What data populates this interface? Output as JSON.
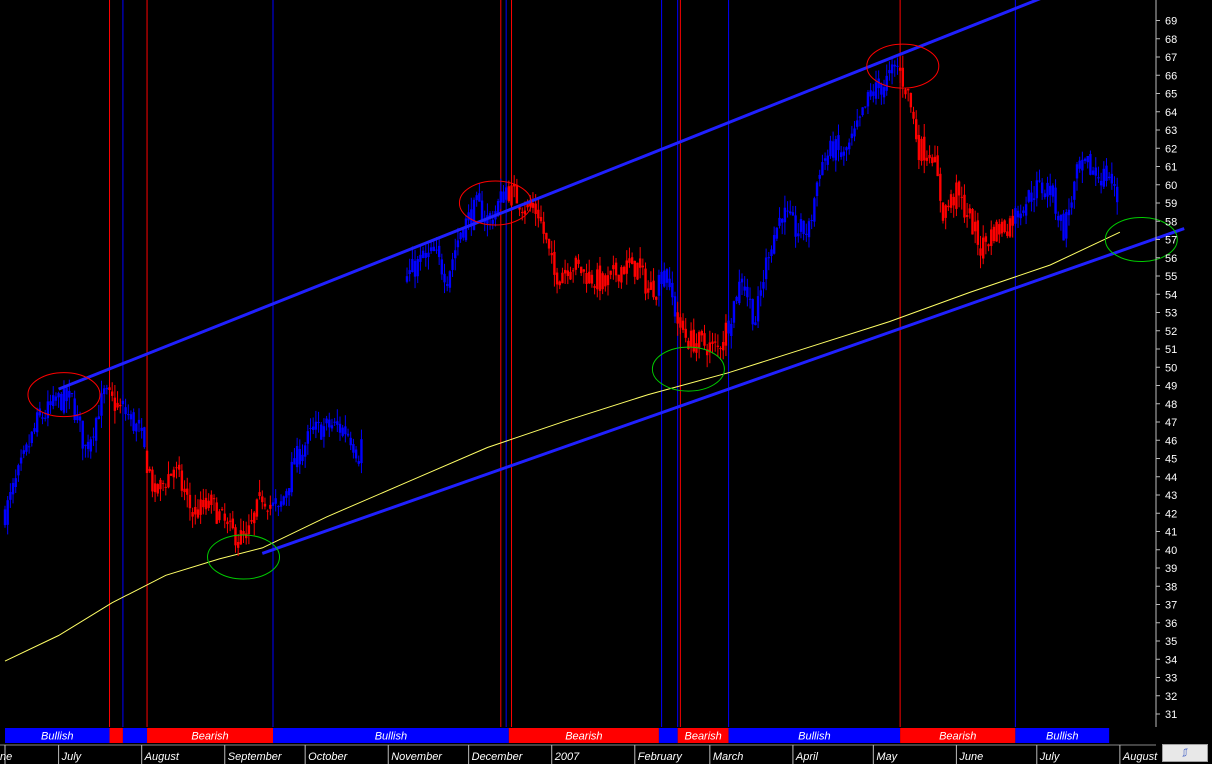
{
  "chart_data": {
    "type": "candlestick",
    "y_axis": {
      "ticks": [
        31,
        32,
        33,
        34,
        35,
        36,
        37,
        38,
        39,
        40,
        41,
        42,
        43,
        44,
        45,
        46,
        47,
        48,
        49,
        50,
        51,
        52,
        53,
        54,
        55,
        56,
        57,
        58,
        59,
        60,
        61,
        62,
        63,
        64,
        65,
        66,
        67,
        68,
        69
      ],
      "side": "right"
    },
    "x_axis": {
      "months": [
        {
          "label": "ne",
          "day": 0
        },
        {
          "label": "July",
          "day": 20
        },
        {
          "label": "August",
          "day": 51
        },
        {
          "label": "September",
          "day": 82
        },
        {
          "label": "October",
          "day": 112
        },
        {
          "label": "November",
          "day": 143
        },
        {
          "label": "December",
          "day": 173
        },
        {
          "label": "2007",
          "day": 204
        },
        {
          "label": "February",
          "day": 235
        },
        {
          "label": "March",
          "day": 263
        },
        {
          "label": "April",
          "day": 294
        },
        {
          "label": "May",
          "day": 324
        },
        {
          "label": "June",
          "day": 355
        },
        {
          "label": "July",
          "day": 385
        },
        {
          "label": "August",
          "day": 416
        }
      ],
      "day_range": [
        0,
        456
      ]
    },
    "price_keypoints": [
      [
        0,
        42
      ],
      [
        6,
        44.5
      ],
      [
        12,
        47
      ],
      [
        20,
        48.2
      ],
      [
        25,
        48.2
      ],
      [
        30,
        45.5
      ],
      [
        37,
        48.5
      ],
      [
        45,
        47.5
      ],
      [
        50,
        46.5
      ],
      [
        56,
        43
      ],
      [
        63,
        44.5
      ],
      [
        70,
        42
      ],
      [
        77,
        42.5
      ],
      [
        84,
        41
      ],
      [
        90,
        40.5
      ],
      [
        96,
        43
      ],
      [
        102,
        42
      ],
      [
        108,
        44.8
      ],
      [
        115,
        46.5
      ],
      [
        122,
        46.8
      ],
      [
        128,
        46.5
      ],
      [
        132,
        45.2
      ],
      [
        138,
        49.5
      ],
      [
        145,
        52.5
      ],
      [
        150,
        55
      ],
      [
        155,
        55.8
      ],
      [
        160,
        56.2
      ],
      [
        165,
        55
      ],
      [
        170,
        57.5
      ],
      [
        176,
        58.8
      ],
      [
        181,
        58
      ],
      [
        187,
        59.8
      ],
      [
        193,
        59
      ],
      [
        199,
        58.5
      ],
      [
        205,
        55
      ],
      [
        211,
        55.7
      ],
      [
        218,
        55
      ],
      [
        224,
        54.5
      ],
      [
        230,
        55.5
      ],
      [
        236,
        55.5
      ],
      [
        240,
        54.3
      ],
      [
        243,
        54.5
      ],
      [
        246,
        55.5
      ],
      [
        251,
        52.5
      ],
      [
        255,
        51.5
      ],
      [
        260,
        51.3
      ],
      [
        266,
        51
      ],
      [
        270,
        52.5
      ],
      [
        275,
        55
      ],
      [
        280,
        52.5
      ],
      [
        285,
        56.5
      ],
      [
        290,
        58.5
      ],
      [
        295,
        57.5
      ],
      [
        300,
        57.5
      ],
      [
        304,
        61
      ],
      [
        309,
        62
      ],
      [
        313,
        61.5
      ],
      [
        318,
        63
      ],
      [
        323,
        65
      ],
      [
        328,
        65.5
      ],
      [
        333,
        66.5
      ],
      [
        337,
        65
      ],
      [
        341,
        62
      ],
      [
        346,
        61.8
      ],
      [
        350,
        58.5
      ],
      [
        355,
        59.5
      ],
      [
        360,
        58.2
      ],
      [
        364,
        56.5
      ],
      [
        369,
        57.5
      ],
      [
        374,
        57.8
      ],
      [
        380,
        59
      ],
      [
        385,
        59.8
      ],
      [
        390,
        59.8
      ],
      [
        395,
        57.5
      ],
      [
        400,
        60.5
      ],
      [
        404,
        61
      ],
      [
        408,
        60.5
      ],
      [
        412,
        60.5
      ],
      [
        415,
        59.2
      ]
    ],
    "gap": [
      133,
      150
    ],
    "channel_lines": [
      {
        "name": "upper",
        "from": [
          20,
          48.8
        ],
        "to": [
          388,
          70.3
        ]
      },
      {
        "name": "lower",
        "from": [
          96,
          39.8
        ],
        "to": [
          440,
          57.6
        ]
      }
    ],
    "moving_average": [
      [
        0,
        33.9
      ],
      [
        20,
        35.3
      ],
      [
        40,
        37.1
      ],
      [
        60,
        38.6
      ],
      [
        80,
        39.5
      ],
      [
        96,
        40.1
      ],
      [
        120,
        41.8
      ],
      [
        150,
        43.7
      ],
      [
        180,
        45.6
      ],
      [
        210,
        47.1
      ],
      [
        240,
        48.5
      ],
      [
        270,
        49.7
      ],
      [
        300,
        51.1
      ],
      [
        330,
        52.5
      ],
      [
        360,
        54.1
      ],
      [
        390,
        55.6
      ],
      [
        416,
        57.4
      ]
    ],
    "highlight_circles": [
      {
        "color": "#ff0000",
        "day": 22,
        "price": 48.5
      },
      {
        "color": "#ff0000",
        "day": 183,
        "price": 59.0
      },
      {
        "color": "#ff0000",
        "day": 335,
        "price": 66.5
      },
      {
        "color": "#00cc00",
        "day": 89,
        "price": 39.6
      },
      {
        "color": "#00cc00",
        "day": 255,
        "price": 49.9
      },
      {
        "color": "#00cc00",
        "day": 424,
        "price": 57.0
      }
    ],
    "signal_lines": [
      {
        "color": "#ff0000",
        "day": 39
      },
      {
        "color": "#0000ff",
        "day": 44
      },
      {
        "color": "#ff0000",
        "day": 53
      },
      {
        "color": "#0000ff",
        "day": 100
      },
      {
        "color": "#ff0000",
        "day": 185
      },
      {
        "color": "#0000ff",
        "day": 187
      },
      {
        "color": "#ff0000",
        "day": 189
      },
      {
        "color": "#0000ff",
        "day": 245
      },
      {
        "color": "#0000ff",
        "day": 251
      },
      {
        "color": "#ff0000",
        "day": 252
      },
      {
        "color": "#0000ff",
        "day": 270
      },
      {
        "color": "#ff0000",
        "day": 334
      },
      {
        "color": "#0000ff",
        "day": 377
      }
    ],
    "regime_bands": [
      {
        "label": "Bullish",
        "state": "bullish",
        "start": 0,
        "end": 39
      },
      {
        "label": "",
        "state": "bearish",
        "start": 39,
        "end": 44
      },
      {
        "label": "",
        "state": "bullish",
        "start": 44,
        "end": 53
      },
      {
        "label": "Bearish",
        "state": "bearish",
        "start": 53,
        "end": 100
      },
      {
        "label": "Bullish",
        "state": "bullish",
        "start": 100,
        "end": 188
      },
      {
        "label": "Bearish",
        "state": "bearish",
        "start": 188,
        "end": 244
      },
      {
        "label": "",
        "state": "bullish",
        "start": 244,
        "end": 251
      },
      {
        "label": "Bearish",
        "state": "bearish",
        "start": 251,
        "end": 270
      },
      {
        "label": "Bullish",
        "state": "bullish",
        "start": 270,
        "end": 334
      },
      {
        "label": "Bearish",
        "state": "bearish",
        "start": 334,
        "end": 377
      },
      {
        "label": "Bullish",
        "state": "bullish",
        "start": 377,
        "end": 412
      }
    ],
    "colors": {
      "bullish": "#0000ff",
      "bearish": "#ff0000",
      "background": "#000000",
      "axis_text": "#ffffff",
      "moving_average": "#ffff66",
      "channel": "#2020ff"
    }
  },
  "corner_button": {
    "icon": "chart-toggle-icon",
    "glyph": "⎎"
  }
}
